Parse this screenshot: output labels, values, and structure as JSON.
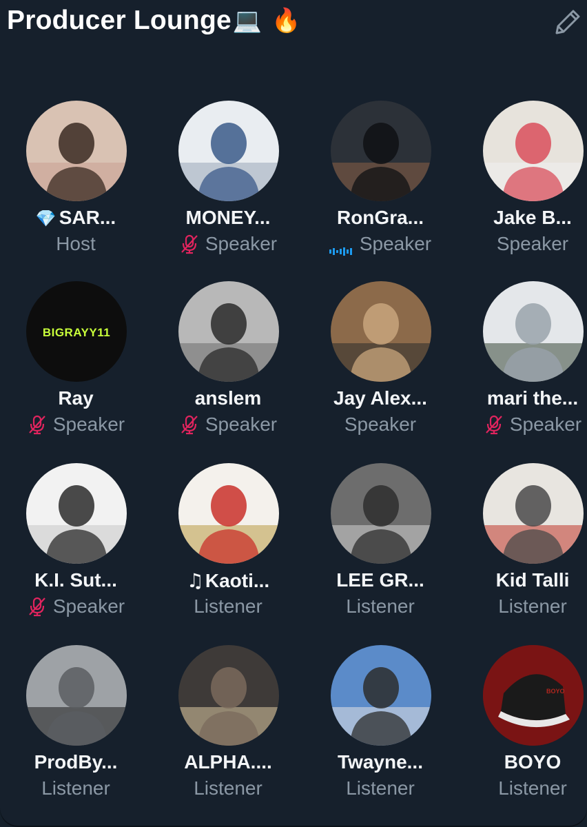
{
  "space": {
    "title": "Producer Lounge",
    "title_emoji_1": "💻",
    "title_emoji_2": "🔥",
    "edit_icon": "pencil-icon"
  },
  "colors": {
    "background": "#16202c",
    "name": "#f3f5f7",
    "role": "#8b98a5",
    "muted_mic": "#e0245e",
    "speaking": "#1d9bf0"
  },
  "participants": [
    {
      "prefix": "💎",
      "name": "SAR...",
      "role": "Host",
      "status": "none"
    },
    {
      "prefix": "",
      "name": "MONEY...",
      "role": "Speaker",
      "status": "muted"
    },
    {
      "prefix": "",
      "name": "RonGra...",
      "role": "Speaker",
      "status": "speaking"
    },
    {
      "prefix": "",
      "name": "Jake B...",
      "role": "Speaker",
      "status": "none"
    },
    {
      "prefix": "",
      "name": "Ray",
      "role": "Speaker",
      "status": "muted",
      "avatar_text": "BIGRAYY11"
    },
    {
      "prefix": "",
      "name": "anslem",
      "role": "Speaker",
      "status": "muted"
    },
    {
      "prefix": "",
      "name": "Jay Alex...",
      "role": "Speaker",
      "status": "none"
    },
    {
      "prefix": "",
      "name": "mari the...",
      "role": "Speaker",
      "status": "muted"
    },
    {
      "prefix": "",
      "name": "K.I. Sut...",
      "role": "Speaker",
      "status": "muted"
    },
    {
      "prefix": "♫",
      "name": "Kaoti...",
      "role": "Listener",
      "status": "none"
    },
    {
      "prefix": "",
      "name": "LEE GR...",
      "role": "Listener",
      "status": "none"
    },
    {
      "prefix": "",
      "name": "Kid Talli",
      "role": "Listener",
      "status": "none"
    },
    {
      "prefix": "",
      "name": "ProdBy...",
      "role": "Listener",
      "status": "none"
    },
    {
      "prefix": "",
      "name": "ALPHA....",
      "role": "Listener",
      "status": "none"
    },
    {
      "prefix": "",
      "name": "Twayne...",
      "role": "Listener",
      "status": "none"
    },
    {
      "prefix": "",
      "name": "BOYO",
      "role": "Listener",
      "status": "none",
      "avatar_text": "BOYO"
    }
  ]
}
